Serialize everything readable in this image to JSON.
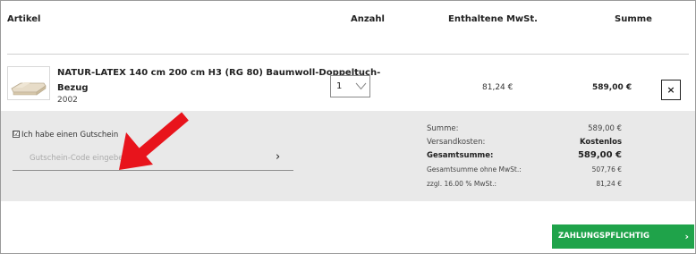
{
  "table": {
    "headers": {
      "article": "Artikel",
      "quantity": "Anzahl",
      "vat": "Enthaltene MwSt.",
      "total": "Summe"
    }
  },
  "product": {
    "name_line1": "NATUR-LATEX 140 cm 200 cm H3 (RG 80) Baumwoll-Doppeltuch-",
    "name_line2": "Bezug",
    "number": "2002",
    "quantity": "1",
    "vat": "81,24 €",
    "total": "589,00 €",
    "remove_label": "×"
  },
  "coupon": {
    "checkbox_mark": "☑",
    "label": "Ich habe einen Gutschein",
    "placeholder": "Gutschein-Code eingeben",
    "submit_icon": "›"
  },
  "totals": {
    "summe_label": "Summe:",
    "summe_value": "589,00 €",
    "shipping_label": "Versandkosten:",
    "shipping_value": "Kostenlos",
    "grand_label": "Gesamtsumme:",
    "grand_value": "589,00 €",
    "net_label": "Gesamtsumme ohne MwSt.:",
    "net_value": "507,76 €",
    "vat_label": "zzgl. 16.00 % MwSt.:",
    "vat_value": "81,24 €"
  },
  "checkout": {
    "order_label": "ZAHLUNGSPFLICHTIG BESTELLEN",
    "order_icon": "›",
    "accent": "#1fa34a"
  },
  "annotation": {
    "arrow_color": "#e8141c"
  }
}
